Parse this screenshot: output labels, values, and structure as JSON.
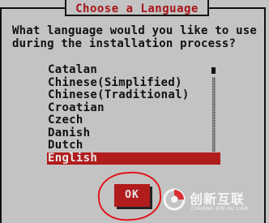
{
  "dialog": {
    "title": "Choose a Language",
    "question_line1": "What language would you like to use",
    "question_line2": "during the installation process?"
  },
  "language_list": {
    "items": [
      "Catalan",
      "Chinese(Simplified)",
      "Chinese(Traditional)",
      "Croatian",
      "Czech",
      "Danish",
      "Dutch",
      "English"
    ],
    "selected": "English"
  },
  "buttons": {
    "ok_label": "OK"
  },
  "watermark": {
    "brand_cn": "创新互联",
    "brand_en": "CHUANG XIN HU LIAN"
  },
  "colors": {
    "background": "#c3c3c3",
    "accent_red": "#b11d1d",
    "title_red": "#a8141a",
    "annotation_red": "#e0151b"
  }
}
